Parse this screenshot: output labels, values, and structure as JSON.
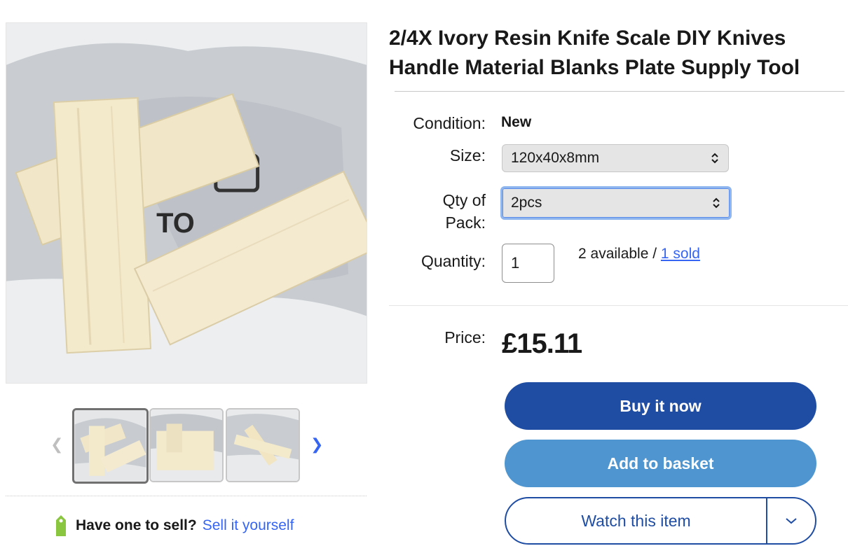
{
  "product": {
    "title": "2/4X Ivory Resin Knife Scale DIY Knives Handle Material Blanks Plate Supply Tool"
  },
  "gallery": {
    "main_image": "ivory-resin-scales-photo",
    "thumbnails": [
      {
        "icon": "thumbnail-image-1",
        "selected": true
      },
      {
        "icon": "thumbnail-image-2",
        "selected": false
      },
      {
        "icon": "thumbnail-image-3",
        "selected": false
      }
    ],
    "prev_icon": "chevron-left-icon",
    "next_icon": "chevron-right-icon"
  },
  "details": {
    "condition_label": "Condition:",
    "condition_value": "New",
    "size_label": "Size:",
    "size_value": "120x40x8mm",
    "qty_pack_label_1": "Qty of",
    "qty_pack_label_2": "Pack:",
    "qty_pack_value": "2pcs",
    "quantity_label": "Quantity:",
    "quantity_value": "1",
    "available_text": "2 available / ",
    "sold_link": "1 sold"
  },
  "pricing": {
    "price_label": "Price:",
    "price_value": "£15.11"
  },
  "actions": {
    "buy_now": "Buy it now",
    "add_to_basket": "Add to basket",
    "watch": "Watch this item"
  },
  "sell": {
    "question": "Have one to sell?",
    "link": "Sell it yourself"
  },
  "colors": {
    "primary_blue": "#1f4da3",
    "secondary_blue": "#4f95cf",
    "link_blue": "#3665f3",
    "tag_green": "#8ac640"
  }
}
